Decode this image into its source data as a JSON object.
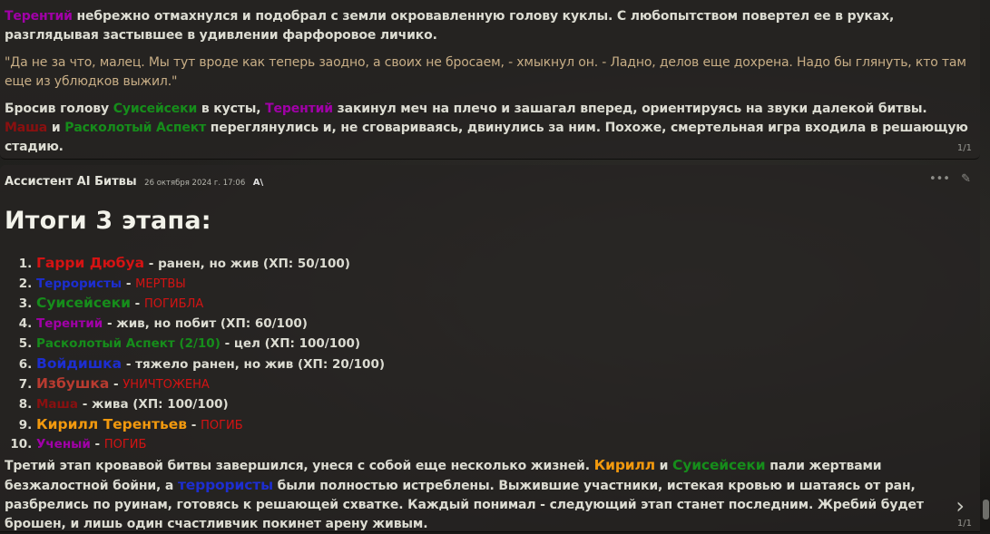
{
  "msg1": {
    "p1": [
      {
        "t": "Терентий",
        "c": "purple"
      },
      {
        "t": " небрежно отмахнулся и подобрал с земли окровавленную голову куклы. С любопытством повертел ее в руках, разглядывая застывшее в удивлении фарфоровое личико.",
        "c": ""
      }
    ],
    "p2": "\"Да не за что, малец. Мы тут вроде как теперь заодно, а своих не бросаем, - хмыкнул он. - Ладно, делов еще дохрена. Надо бы глянуть, кто там еще из ублюдков выжил.\"",
    "p3": [
      {
        "t": "Бросив голову ",
        "c": ""
      },
      {
        "t": "Суисейсеки",
        "c": "green"
      },
      {
        "t": " в кусты, ",
        "c": ""
      },
      {
        "t": "Терентий",
        "c": "purple"
      },
      {
        "t": " закинул меч на плечо и зашагал вперед, ориентируясь на звуки далекой битвы. ",
        "c": ""
      },
      {
        "t": "Маша",
        "c": "darkred"
      },
      {
        "t": " и ",
        "c": ""
      },
      {
        "t": "Расколотый Аспект",
        "c": "green"
      },
      {
        "t": " переглянулись и, не сговариваясь, двинулись за ним. Похоже, смертельная игра входила в решающую стадию.",
        "c": ""
      }
    ],
    "swipe": "1/1"
  },
  "msg2": {
    "author": "Ассистент AI Битвы",
    "timestamp": "26 октября 2024 г. 17:06",
    "ai_badge": "A\\",
    "tools": {
      "more": "•••",
      "edit": "✎"
    },
    "heading": "Итоги 3 этапа:",
    "list": [
      {
        "name": "Гарри Дюбуа",
        "c": "red",
        "big": true,
        "sep": " - ",
        "status": "ранен, но жив (ХП: 50/100)",
        "sc": ""
      },
      {
        "name": "Террористы",
        "c": "blue",
        "big": false,
        "sep": " - ",
        "status": "МЕРТВЫ",
        "sc": "red"
      },
      {
        "name": "Суисейсеки",
        "c": "green",
        "big": true,
        "sep": " - ",
        "status": "ПОГИБЛА",
        "sc": "red"
      },
      {
        "name": "Терентий",
        "c": "purple",
        "big": false,
        "sep": " - ",
        "status": "жив, но побит (ХП: 60/100)",
        "sc": ""
      },
      {
        "name": "Расколотый Аспект (2/10)",
        "c": "green",
        "big": false,
        "sep": " - ",
        "status": "цел (ХП: 100/100)",
        "sc": ""
      },
      {
        "name": "Войдишка",
        "c": "blue",
        "big": true,
        "sep": " - ",
        "status": "тяжело ранен, но жив (ХП: 20/100)",
        "sc": ""
      },
      {
        "name": "Избушка",
        "c": "brown",
        "big": true,
        "sep": " - ",
        "status": "УНИЧТОЖЕНА",
        "sc": "red"
      },
      {
        "name": "Маша",
        "c": "darkred",
        "big": false,
        "sep": " - ",
        "status": "жива (ХП: 100/100)",
        "sc": ""
      },
      {
        "name": "Кирилл Терентьев",
        "c": "orange",
        "big": true,
        "sep": " - ",
        "status": "ПОГИБ",
        "sc": "red"
      },
      {
        "name": "Ученый",
        "c": "purple",
        "big": false,
        "sep": " - ",
        "status": "ПОГИБ",
        "sc": "red"
      }
    ],
    "p4": [
      {
        "t": "Третий этап кровавой битвы завершился, унеся с собой еще несколько жизней. ",
        "c": ""
      },
      {
        "t": "Кирилл",
        "c": "orange big"
      },
      {
        "t": " и ",
        "c": ""
      },
      {
        "t": "Суисейсеки",
        "c": "green big"
      },
      {
        "t": " пали жертвами безжалостной бойни, а ",
        "c": ""
      },
      {
        "t": "террористы",
        "c": "blue big"
      },
      {
        "t": " были полностью истреблены. Выжившие участники, истекая кровью и шатаясь от ран, разбрелись по руинам, готовясь к решающей схватке. Каждый понимал - следующий этап станет последним. Жребий будет брошен, и лишь один счастливчик покинет арену живым.",
        "c": ""
      }
    ],
    "next_icon": "›",
    "swipe": "1/1"
  }
}
